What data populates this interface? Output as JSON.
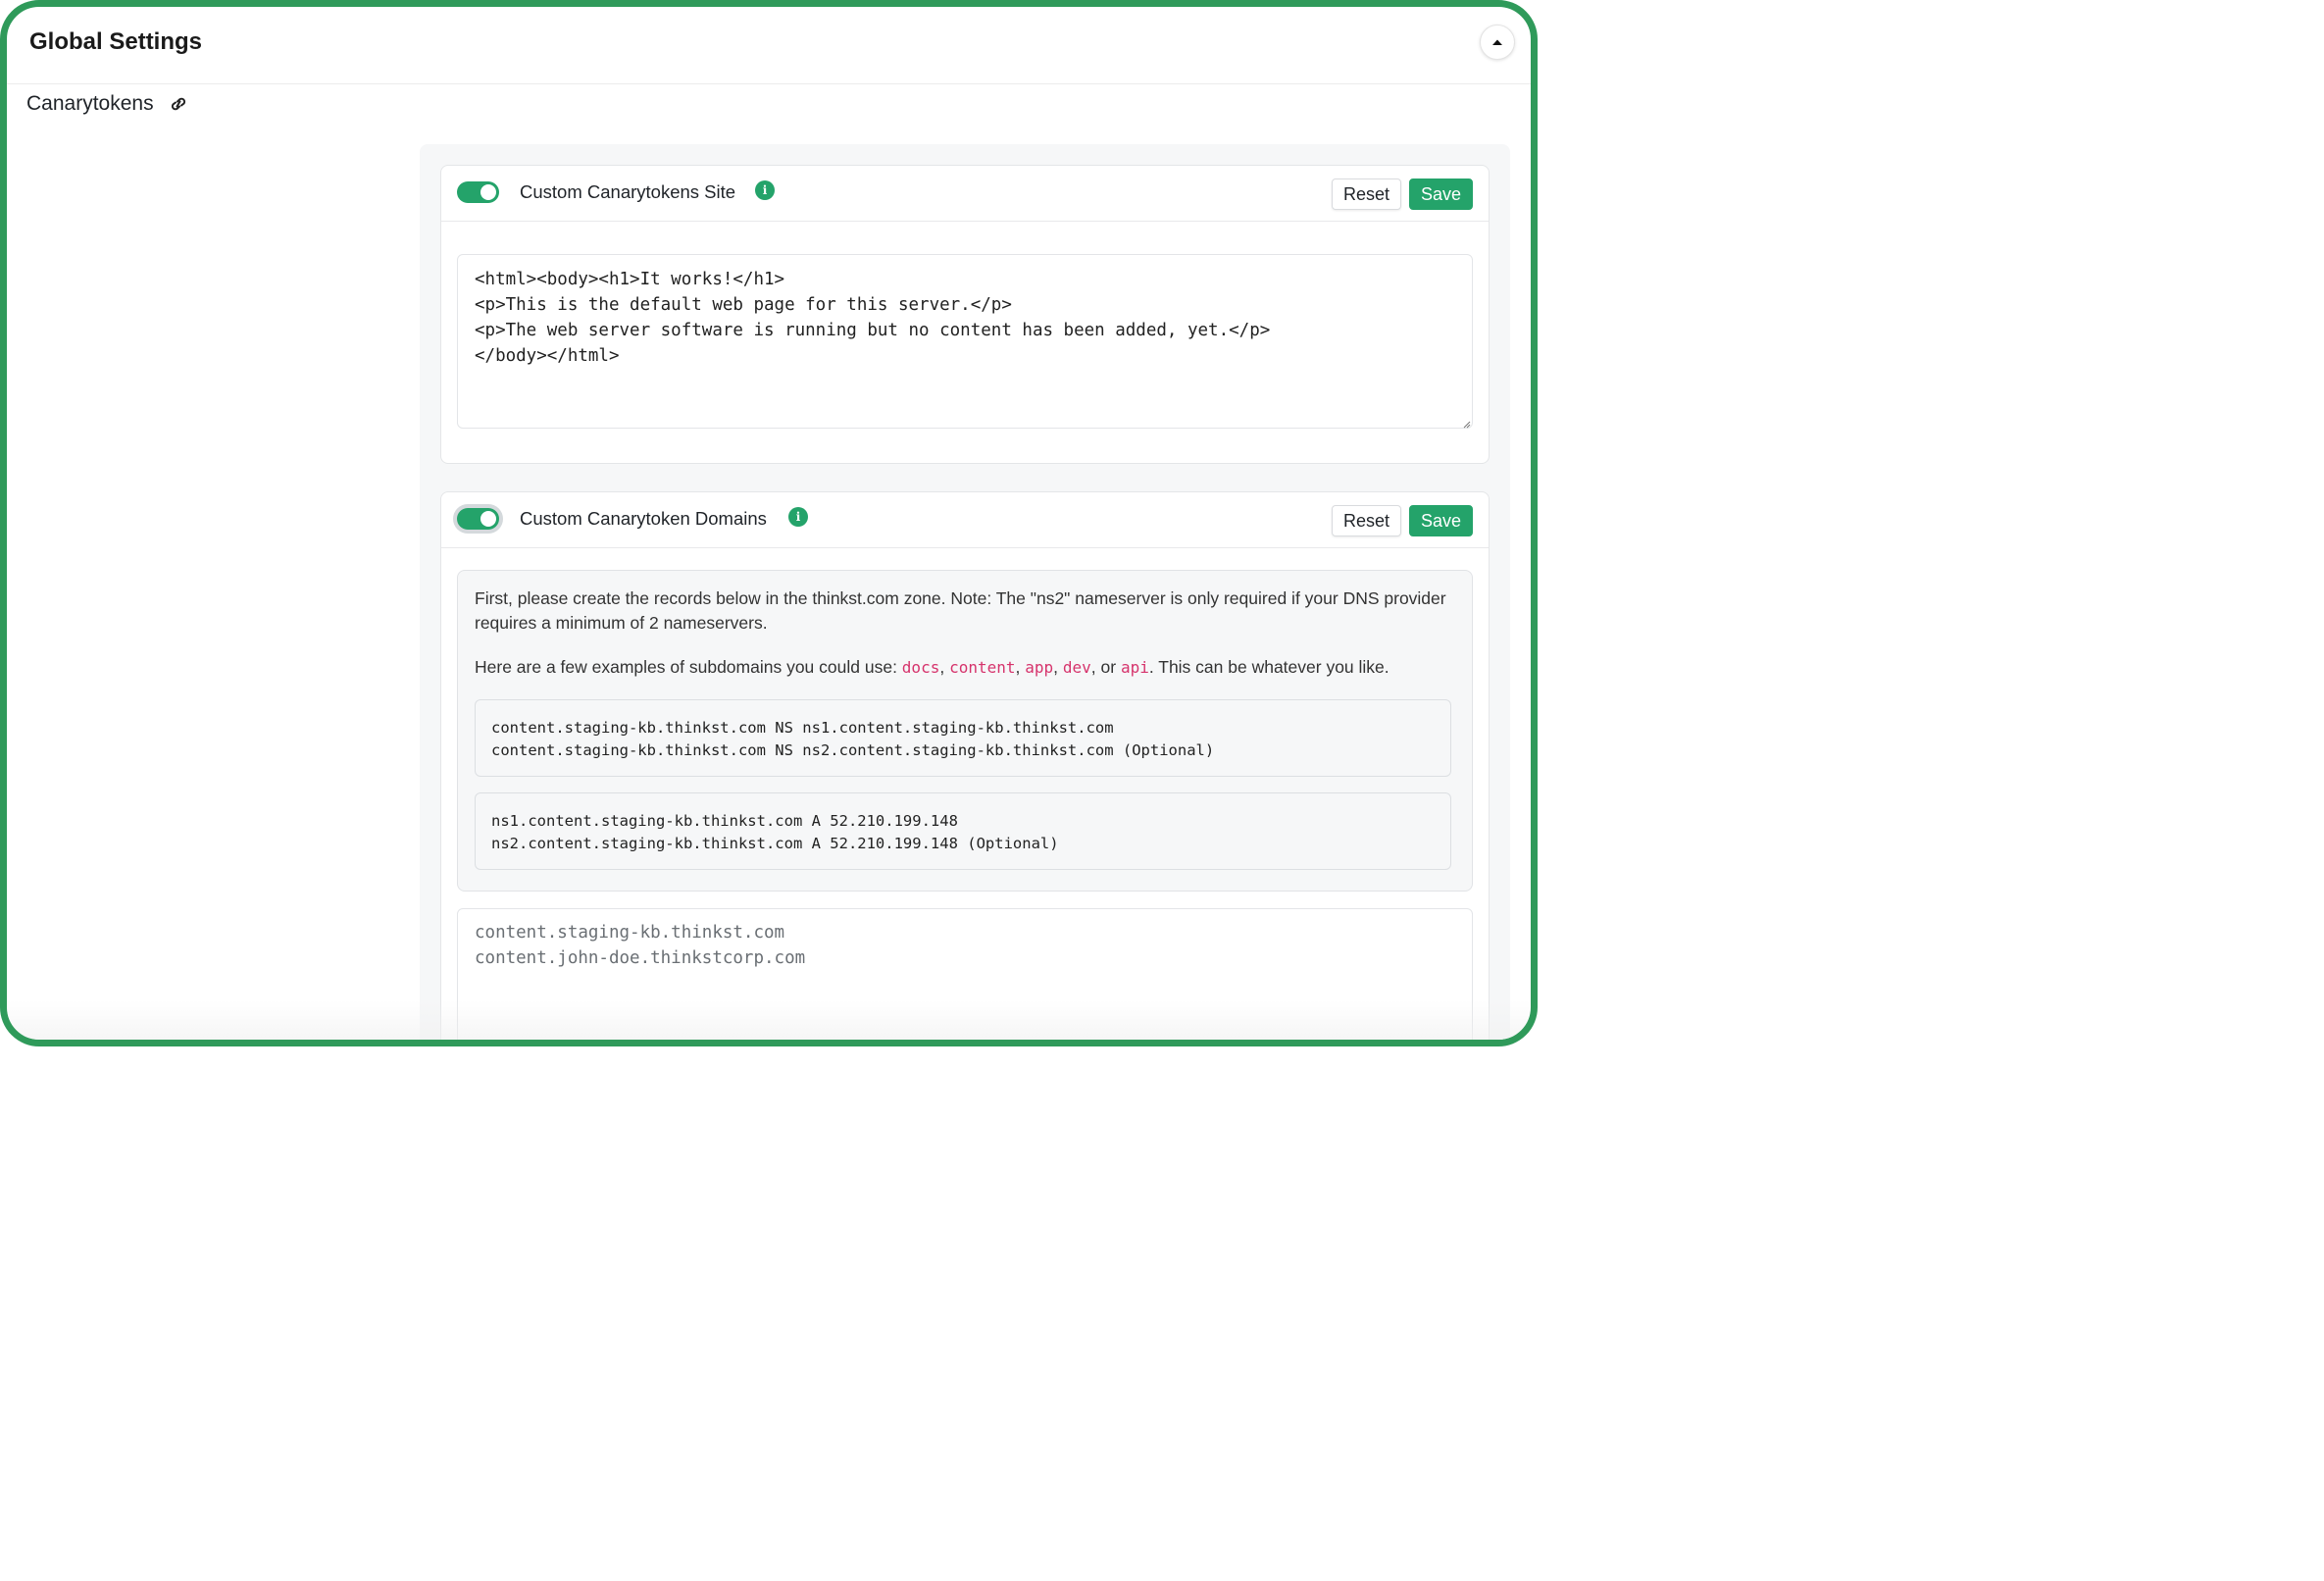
{
  "header": {
    "title": "Global Settings"
  },
  "section": {
    "label": "Canarytokens"
  },
  "site_card": {
    "title": "Custom Canarytokens Site",
    "enabled": true,
    "reset_label": "Reset",
    "save_label": "Save",
    "html_content": "<html><body><h1>It works!</h1>\n<p>This is the default web page for this server.</p>\n<p>The web server software is running but no content has been added, yet.</p>\n</body></html>"
  },
  "domains_card": {
    "title": "Custom Canarytoken Domains",
    "enabled": true,
    "reset_label": "Reset",
    "save_label": "Save",
    "intro_text": "First, please create the records below in the thinkst.com zone. Note: The \"ns2\" nameserver is only required if your DNS provider requires a minimum of 2 nameservers.",
    "examples_prefix": "Here are a few examples of subdomains you could use: ",
    "examples": [
      "docs",
      "content",
      "app",
      "dev",
      "api"
    ],
    "examples_suffix": ". This can be whatever you like.",
    "ns_records": "content.staging-kb.thinkst.com NS ns1.content.staging-kb.thinkst.com\ncontent.staging-kb.thinkst.com NS ns2.content.staging-kb.thinkst.com (Optional)",
    "a_records": "ns1.content.staging-kb.thinkst.com A 52.210.199.148\nns2.content.staging-kb.thinkst.com A 52.210.199.148 (Optional)",
    "domains_placeholder": "content.staging-kb.thinkst.com\ncontent.john-doe.thinkstcorp.com"
  },
  "colors": {
    "accent": "#24a36a",
    "frame": "#2f9a5a",
    "code_highlight": "#d6336c"
  },
  "icons": {
    "collapse": "chevron-up-icon",
    "link": "link-icon",
    "info": "info-icon"
  }
}
